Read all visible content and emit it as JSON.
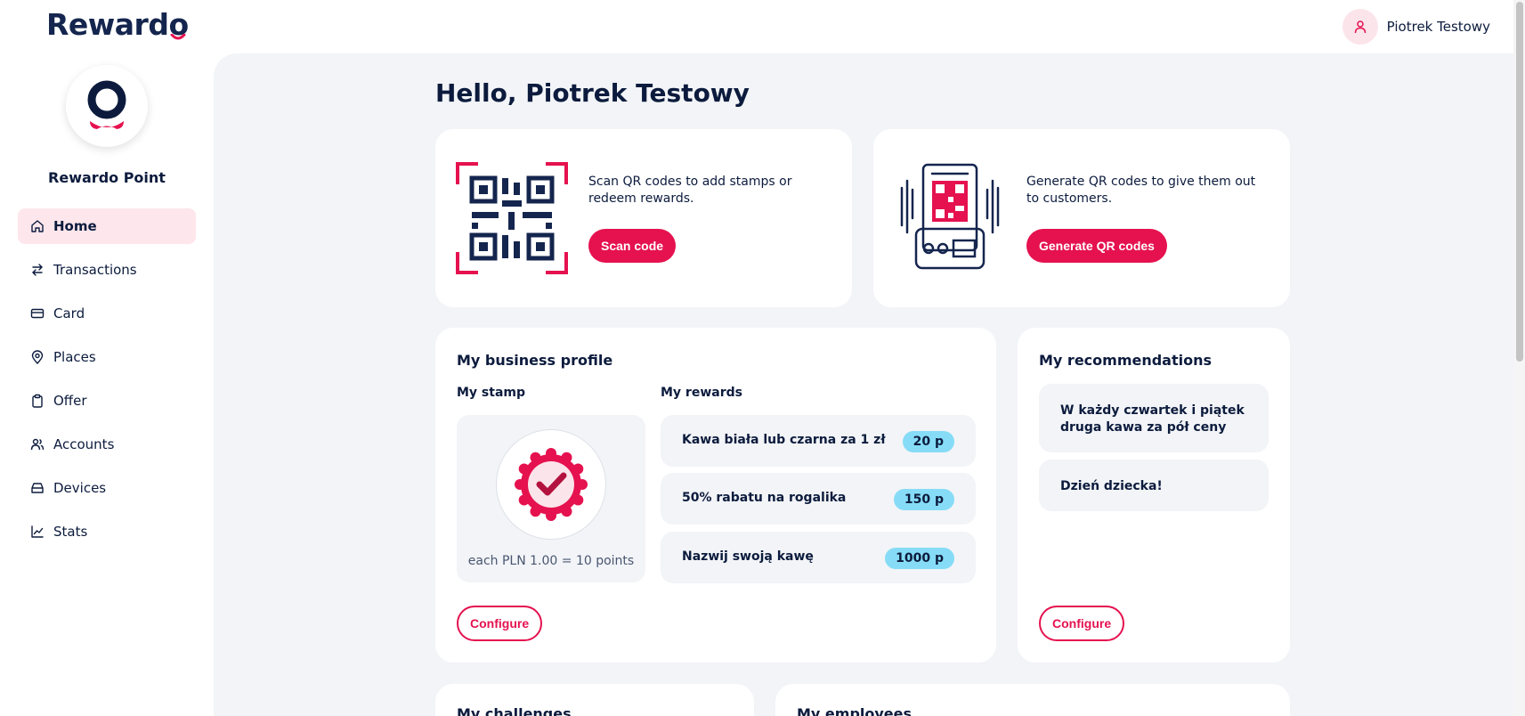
{
  "header": {
    "logo_text": "Rewardo",
    "user_name": "Piotrek Testowy"
  },
  "sidebar": {
    "brand_name": "Rewardo Point",
    "items": [
      {
        "label": "Home",
        "icon": "home-icon",
        "active": true
      },
      {
        "label": "Transactions",
        "icon": "arrows-icon",
        "active": false
      },
      {
        "label": "Card",
        "icon": "card-icon",
        "active": false
      },
      {
        "label": "Places",
        "icon": "map-pin-icon",
        "active": false
      },
      {
        "label": "Offer",
        "icon": "clipboard-icon",
        "active": false
      },
      {
        "label": "Accounts",
        "icon": "users-icon",
        "active": false
      },
      {
        "label": "Devices",
        "icon": "device-icon",
        "active": false
      },
      {
        "label": "Stats",
        "icon": "chart-icon",
        "active": false
      }
    ]
  },
  "main": {
    "greeting": "Hello, Piotrek Testowy",
    "scan_card": {
      "text": "Scan QR codes to add stamps or redeem rewards.",
      "button": "Scan code"
    },
    "generate_card": {
      "text": "Generate QR codes to give them out to customers.",
      "button": "Generate QR codes"
    },
    "business_profile": {
      "title": "My business profile",
      "stamp_title": "My stamp",
      "stamp_caption": "each PLN 1.00 = 10 points",
      "rewards_title": "My rewards",
      "rewards": [
        {
          "name": "Kawa biała lub czarna za 1 zł",
          "points": "20 p"
        },
        {
          "name": "50% rabatu na rogalika",
          "points": "150 p"
        },
        {
          "name": "Nazwij swoją kawę",
          "points": "1000 p"
        }
      ],
      "configure": "Configure"
    },
    "recommendations": {
      "title": "My recommendations",
      "items": [
        "W każdy czwartek i piątek druga kawa za pół ceny",
        "Dzień dziecka!"
      ],
      "configure": "Configure"
    },
    "challenges_title": "My challenges",
    "employees_title": "My employees"
  },
  "colors": {
    "accent": "#e5124f",
    "navy": "#0c1b3d",
    "badge": "#86dcf6",
    "background": "#f2f4f7"
  }
}
